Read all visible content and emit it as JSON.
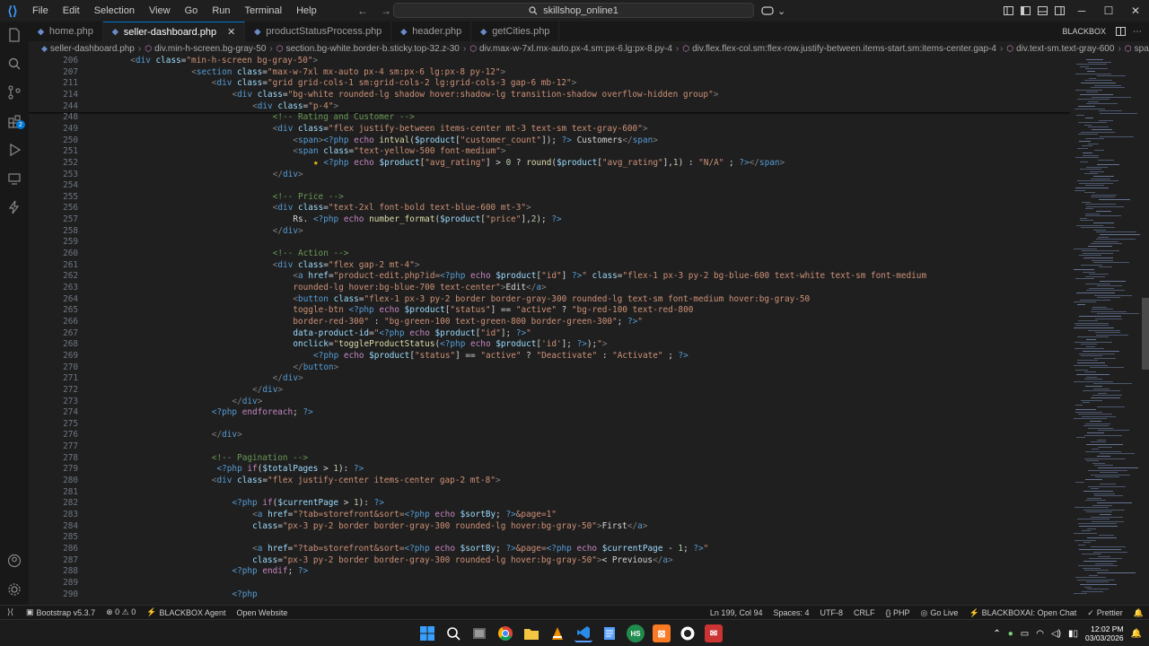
{
  "titlebar": {
    "menu": [
      "File",
      "Edit",
      "Selection",
      "View",
      "Go",
      "Run",
      "Terminal",
      "Help"
    ],
    "search_text": "skillshop_online1",
    "nav_back": "←",
    "nav_forward": "→"
  },
  "tabs": [
    {
      "label": "home.php",
      "active": false
    },
    {
      "label": "seller-dashboard.php",
      "active": true
    },
    {
      "label": "productStatusProcess.php",
      "active": false
    },
    {
      "label": "header.php",
      "active": false
    },
    {
      "label": "getCities.php",
      "active": false
    }
  ],
  "blackbox_label": "BLACKBOX",
  "breadcrumb": [
    "seller-dashboard.php",
    "div.min-h-screen.bg-gray-50",
    "section.bg-white.border-b.sticky.top-32.z-30",
    "div.max-w-7xl.mx-auto.px-4.sm:px-6.lg:px-8.py-4",
    "div.flex.flex-col.sm:flex-row.justify-between.items-start.sm:items-center.gap-4",
    "div.text-sm.text-gray-600",
    "span.font-bold"
  ],
  "code_lines": [
    {
      "n": "206",
      "indent": 8,
      "html": "<span class='g'>&lt;</span><span class='t'>div</span> <span class='a'>class</span>=<span class='s'>\"min-h-screen bg-gray-50\"</span><span class='g'>&gt;</span>"
    },
    {
      "n": "207",
      "indent": 20,
      "html": "<span class='g'>&lt;</span><span class='t'>section</span> <span class='a'>class</span>=<span class='s'>\"max-w-7xl mx-auto px-4 sm:px-6 lg:px-8 py-12\"</span><span class='g'>&gt;</span>"
    },
    {
      "n": "211",
      "indent": 24,
      "html": "<span class='g'>&lt;</span><span class='t'>div</span> <span class='a'>class</span>=<span class='s'>\"grid grid-cols-1 sm:grid-cols-2 lg:grid-cols-3 gap-6 mb-12\"</span><span class='g'>&gt;</span>"
    },
    {
      "n": "214",
      "indent": 28,
      "html": "<span class='g'>&lt;</span><span class='t'>div</span> <span class='a'>class</span>=<span class='s'>\"bg-white rounded-lg shadow hover:shadow-lg transition-shadow overflow-hidden group\"</span><span class='g'>&gt;</span>"
    },
    {
      "n": "244",
      "indent": 32,
      "html": "<span class='g'>&lt;</span><span class='t'>div</span> <span class='a'>class</span>=<span class='s'>\"p-4\"</span><span class='g'>&gt;</span>"
    },
    {
      "n": "248",
      "indent": 36,
      "html": "<span class='c'>&lt;!-- Rating and Customer --&gt;</span>"
    },
    {
      "n": "249",
      "indent": 36,
      "html": "<span class='g'>&lt;</span><span class='t'>div</span> <span class='a'>class</span>=<span class='s'>\"flex justify-between items-center mt-3 text-sm text-gray-600\"</span><span class='g'>&gt;</span>"
    },
    {
      "n": "250",
      "indent": 40,
      "html": "<span class='g'>&lt;</span><span class='t'>span</span><span class='g'>&gt;</span><span class='p'>&lt;?php</span> <span class='k'>echo</span> <span class='f'>intval</span>(<span class='v'>$product</span>[<span class='s'>\"customer_count\"</span>]); <span class='p'>?&gt;</span> Customers<span class='g'>&lt;/</span><span class='t'>span</span><span class='g'>&gt;</span>"
    },
    {
      "n": "251",
      "indent": 40,
      "html": "<span class='g'>&lt;</span><span class='t'>span</span> <span class='a'>class</span>=<span class='s'>\"text-yellow-500 font-medium\"</span><span class='g'>&gt;</span>"
    },
    {
      "n": "252",
      "indent": 44,
      "html": "<span style='color:#f5c518'>★</span> <span class='p'>&lt;?php</span> <span class='k'>echo</span> <span class='v'>$product</span>[<span class='s'>\"avg_rating\"</span>] &gt; <span class='n'>0</span> ? <span class='f'>round</span>(<span class='v'>$product</span>[<span class='s'>\"avg_rating\"</span>],<span class='n'>1</span>) : <span class='s'>\"N/A\"</span> ; <span class='p'>?&gt;</span><span class='g'>&lt;/</span><span class='t'>span</span><span class='g'>&gt;</span>"
    },
    {
      "n": "253",
      "indent": 36,
      "html": "<span class='g'>&lt;/</span><span class='t'>div</span><span class='g'>&gt;</span>"
    },
    {
      "n": "254",
      "indent": 0,
      "html": ""
    },
    {
      "n": "255",
      "indent": 36,
      "html": "<span class='c'>&lt;!-- Price --&gt;</span>"
    },
    {
      "n": "256",
      "indent": 36,
      "html": "<span class='g'>&lt;</span><span class='t'>div</span> <span class='a'>class</span>=<span class='s'>\"text-2xl font-bold text-blue-600 mt-3\"</span><span class='g'>&gt;</span>"
    },
    {
      "n": "257",
      "indent": 40,
      "html": "Rs. <span class='p'>&lt;?php</span> <span class='k'>echo</span> <span class='f'>number_format</span>(<span class='v'>$product</span>[<span class='s'>\"price\"</span>],<span class='n'>2</span>); <span class='p'>?&gt;</span>"
    },
    {
      "n": "258",
      "indent": 36,
      "html": "<span class='g'>&lt;/</span><span class='t'>div</span><span class='g'>&gt;</span>"
    },
    {
      "n": "259",
      "indent": 0,
      "html": ""
    },
    {
      "n": "260",
      "indent": 36,
      "html": "<span class='c'>&lt;!-- Action --&gt;</span>"
    },
    {
      "n": "261",
      "indent": 36,
      "html": "<span class='g'>&lt;</span><span class='t'>div</span> <span class='a'>class</span>=<span class='s'>\"flex gap-2 mt-4\"</span><span class='g'>&gt;</span>"
    },
    {
      "n": "262",
      "indent": 40,
      "html": "<span class='g'>&lt;</span><span class='t'>a</span> <span class='a'>href</span>=<span class='s'>\"product-edit.php?id=</span><span class='p'>&lt;?php</span> <span class='k'>echo</span> <span class='v'>$product</span>[<span class='s'>\"id\"</span>] <span class='p'>?&gt;</span><span class='s'>\"</span> <span class='a'>class</span>=<span class='s'>\"flex-1 px-3 py-2 bg-blue-600 text-white text-sm font-medium</span>"
    },
    {
      "n": "263",
      "indent": 40,
      "html": "<span class='s'>rounded-lg hover:bg-blue-700 text-center\"</span><span class='g'>&gt;</span>Edit<span class='g'>&lt;/</span><span class='t'>a</span><span class='g'>&gt;</span>"
    },
    {
      "n": "264",
      "indent": 40,
      "html": "<span class='g'>&lt;</span><span class='t'>button</span> <span class='a'>class</span>=<span class='s'>\"flex-1 px-3 py-2 border border-gray-300 rounded-lg text-sm font-medium hover:bg-gray-50</span>"
    },
    {
      "n": "265",
      "indent": 40,
      "html": "<span class='s'>toggle-btn </span><span class='p'>&lt;?php</span> <span class='k'>echo</span> <span class='v'>$product</span>[<span class='s'>\"status\"</span>] == <span class='s'>\"active\"</span> ? <span class='s'>\"bg-red-100 text-red-800</span>"
    },
    {
      "n": "266",
      "indent": 40,
      "html": "<span class='s'>border-red-300\"</span> : <span class='s'>\"bg-green-100 text-green-800 border-green-300\"</span>; <span class='p'>?&gt;</span><span class='s'>\"</span>"
    },
    {
      "n": "267",
      "indent": 40,
      "html": "<span class='a'>data-product-id</span>=<span class='s'>\"</span><span class='p'>&lt;?php</span> <span class='k'>echo</span> <span class='v'>$product</span>[<span class='s'>\"id\"</span>]; <span class='p'>?&gt;</span><span class='s'>\"</span>"
    },
    {
      "n": "268",
      "indent": 40,
      "html": "<span class='a'>onclick</span>=<span class='s'>\"</span><span class='f'>toggleProductStatus</span>(<span class='p'>&lt;?php</span> <span class='k'>echo</span> <span class='v'>$product</span>[<span class='s'>'id'</span>]; <span class='p'>?&gt;</span>);<span class='s'>\"</span><span class='g'>&gt;</span>"
    },
    {
      "n": "269",
      "indent": 44,
      "html": "<span class='p'>&lt;?php</span> <span class='k'>echo</span> <span class='v'>$product</span>[<span class='s'>\"status\"</span>] == <span class='s'>\"active\"</span> ? <span class='s'>\"Deactivate\"</span> : <span class='s'>\"Activate\"</span> ; <span class='p'>?&gt;</span>"
    },
    {
      "n": "270",
      "indent": 40,
      "html": "<span class='g'>&lt;/</span><span class='t'>button</span><span class='g'>&gt;</span>"
    },
    {
      "n": "271",
      "indent": 36,
      "html": "<span class='g'>&lt;/</span><span class='t'>div</span><span class='g'>&gt;</span>"
    },
    {
      "n": "272",
      "indent": 32,
      "html": "<span class='g'>&lt;/</span><span class='t'>div</span><span class='g'>&gt;</span>"
    },
    {
      "n": "273",
      "indent": 28,
      "html": "<span class='g'>&lt;/</span><span class='t'>div</span><span class='g'>&gt;</span>"
    },
    {
      "n": "274",
      "indent": 24,
      "html": "<span class='p'>&lt;?php</span> <span class='k'>endforeach</span>; <span class='p'>?&gt;</span>"
    },
    {
      "n": "275",
      "indent": 0,
      "html": ""
    },
    {
      "n": "276",
      "indent": 24,
      "html": "<span class='g'>&lt;/</span><span class='t'>div</span><span class='g'>&gt;</span>"
    },
    {
      "n": "277",
      "indent": 0,
      "html": ""
    },
    {
      "n": "278",
      "indent": 24,
      "html": "<span class='c'>&lt;!-- Pagination --&gt;</span>"
    },
    {
      "n": "279",
      "indent": 25,
      "html": "<span class='p'>&lt;?php</span> <span class='k'>if</span>(<span class='v'>$totalPages</span> &gt; <span class='n'>1</span>): <span class='p'>?&gt;</span>"
    },
    {
      "n": "280",
      "indent": 24,
      "html": "<span class='g'>&lt;</span><span class='t'>div</span> <span class='a'>class</span>=<span class='s'>\"flex justify-center items-center gap-2 mt-8\"</span><span class='g'>&gt;</span>"
    },
    {
      "n": "281",
      "indent": 0,
      "html": ""
    },
    {
      "n": "282",
      "indent": 28,
      "html": "<span class='p'>&lt;?php</span> <span class='k'>if</span>(<span class='v'>$currentPage</span> &gt; <span class='n'>1</span>): <span class='p'>?&gt;</span>"
    },
    {
      "n": "283",
      "indent": 32,
      "html": "<span class='g'>&lt;</span><span class='t'>a</span> <span class='a'>href</span>=<span class='s'>\"?tab=storefront&amp;sort=</span><span class='p'>&lt;?php</span> <span class='k'>echo</span> <span class='v'>$sortBy</span>; <span class='p'>?&gt;</span><span class='s'>&amp;page=1\"</span>"
    },
    {
      "n": "284",
      "indent": 32,
      "html": "<span class='a'>class</span>=<span class='s'>\"px-3 py-2 border border-gray-300 rounded-lg hover:bg-gray-50\"</span><span class='g'>&gt;</span>First<span class='g'>&lt;/</span><span class='t'>a</span><span class='g'>&gt;</span>"
    },
    {
      "n": "285",
      "indent": 0,
      "html": ""
    },
    {
      "n": "286",
      "indent": 32,
      "html": "<span class='g'>&lt;</span><span class='t'>a</span> <span class='a'>href</span>=<span class='s'>\"?tab=storefront&amp;sort=</span><span class='p'>&lt;?php</span> <span class='k'>echo</span> <span class='v'>$sortBy</span>; <span class='p'>?&gt;</span><span class='s'>&amp;page=</span><span class='p'>&lt;?php</span> <span class='k'>echo</span> <span class='v'>$currentPage</span> - <span class='n'>1</span>; <span class='p'>?&gt;</span><span class='s'>\"</span>"
    },
    {
      "n": "287",
      "indent": 32,
      "html": "<span class='a'>class</span>=<span class='s'>\"px-3 py-2 border border-gray-300 rounded-lg hover:bg-gray-50\"</span><span class='g'>&gt;</span>&lt; Previous<span class='g'>&lt;/</span><span class='t'>a</span><span class='g'>&gt;</span>"
    },
    {
      "n": "288",
      "indent": 28,
      "html": "<span class='p'>&lt;?php</span> <span class='k'>endif</span>; <span class='p'>?&gt;</span>"
    },
    {
      "n": "289",
      "indent": 0,
      "html": ""
    },
    {
      "n": "290",
      "indent": 28,
      "html": "<span class='p'>&lt;?php</span>"
    }
  ],
  "statusbar": {
    "left": [
      {
        "label": "Bootstrap v5.3.7"
      },
      {
        "label": "⊗ 0 ⚠ 0"
      },
      {
        "label": "BLACKBOX Agent"
      },
      {
        "label": "Open Website"
      }
    ],
    "right": [
      {
        "label": "Ln 199, Col 94"
      },
      {
        "label": "Spaces: 4"
      },
      {
        "label": "UTF-8"
      },
      {
        "label": "CRLF"
      },
      {
        "label": "{} PHP"
      },
      {
        "label": "Go Live"
      },
      {
        "label": "BLACKBOXAI: Open Chat"
      },
      {
        "label": "Prettier"
      }
    ]
  },
  "taskbar": {
    "time": "12:02 PM",
    "date": "03/03/2026"
  }
}
